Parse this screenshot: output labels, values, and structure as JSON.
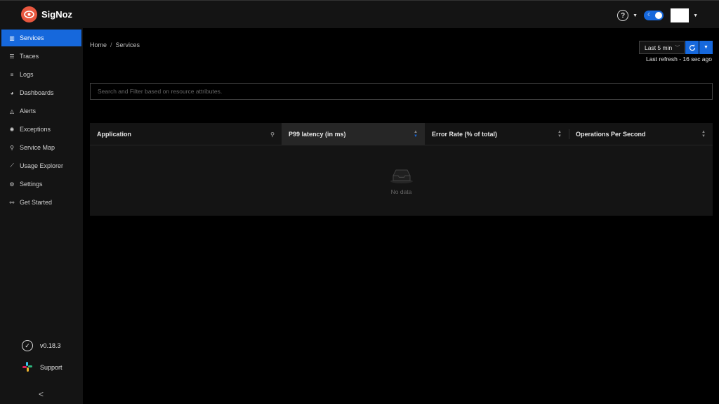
{
  "brand": {
    "name": "SigNoz"
  },
  "header": {
    "help": "?"
  },
  "sidebar": {
    "items": [
      {
        "label": "Services",
        "icon": "bar-chart-icon",
        "glyph": "▥"
      },
      {
        "label": "Traces",
        "icon": "menu-icon",
        "glyph": "☰"
      },
      {
        "label": "Logs",
        "icon": "align-left-icon",
        "glyph": "≡"
      },
      {
        "label": "Dashboards",
        "icon": "dashboard-icon",
        "glyph": "◕"
      },
      {
        "label": "Alerts",
        "icon": "bell-icon",
        "glyph": "◬"
      },
      {
        "label": "Exceptions",
        "icon": "bug-icon",
        "glyph": "✺"
      },
      {
        "label": "Service Map",
        "icon": "deployment-icon",
        "glyph": "⚲"
      },
      {
        "label": "Usage Explorer",
        "icon": "line-chart-icon",
        "glyph": "⟋"
      },
      {
        "label": "Settings",
        "icon": "settings-icon",
        "glyph": "⚙"
      },
      {
        "label": "Get Started",
        "icon": "api-icon",
        "glyph": "⚯"
      }
    ],
    "version": "v0.18.3",
    "support": "Support",
    "collapse": "<"
  },
  "breadcrumb": {
    "home": "Home",
    "current": "Services"
  },
  "toolbar": {
    "time_range": "Last 5 min",
    "last_refresh": "Last refresh - 16 sec ago"
  },
  "search": {
    "placeholder": "Search and Filter based on resource attributes."
  },
  "table": {
    "columns": [
      "Application",
      "P99 latency (in ms)",
      "Error Rate (% of total)",
      "Operations Per Second"
    ],
    "empty_text": "No data"
  },
  "colors": {
    "accent": "#1668dc",
    "logo": "#e8573f",
    "sidebar": "#141414"
  }
}
